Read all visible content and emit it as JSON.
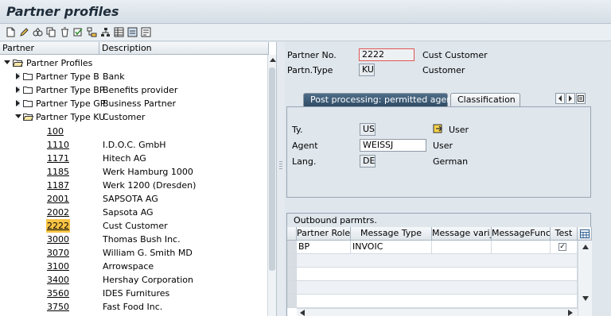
{
  "app": {
    "title": "Partner profiles"
  },
  "toolbar": {
    "buttons": [
      "new-icon",
      "edit-icon",
      "display-icon",
      "copy-icon",
      "delete-icon",
      "check-icon",
      "tree-icon",
      "hierarchy-icon",
      "table-icon",
      "table2-icon",
      "info-icon"
    ]
  },
  "tree": {
    "col_partner": "Partner",
    "col_description": "Description",
    "root": "Partner Profiles",
    "types": [
      {
        "label": "Partner Type B",
        "desc": "Bank"
      },
      {
        "label": "Partner Type BP",
        "desc": "Benefits provider"
      },
      {
        "label": "Partner Type GP",
        "desc": "Business Partner"
      },
      {
        "label": "Partner Type KU",
        "desc": "Customer"
      }
    ],
    "partners": [
      {
        "no": "100",
        "desc": ""
      },
      {
        "no": "1110",
        "desc": "I.D.O.C. GmbH"
      },
      {
        "no": "1171",
        "desc": "Hitech AG"
      },
      {
        "no": "1185",
        "desc": "Werk Hamburg 1000"
      },
      {
        "no": "1187",
        "desc": "Werk 1200 (Dresden)"
      },
      {
        "no": "2001",
        "desc": "SAPSOTA AG"
      },
      {
        "no": "2002",
        "desc": "Sapsota AG"
      },
      {
        "no": "2222",
        "desc": "Cust Customer"
      },
      {
        "no": "3000",
        "desc": "Thomas Bush Inc."
      },
      {
        "no": "3070",
        "desc": "William G. Smith MD"
      },
      {
        "no": "3100",
        "desc": "Arrowspace"
      },
      {
        "no": "3400",
        "desc": "Hershay Corporation"
      },
      {
        "no": "3560",
        "desc": "IDES Furnitures"
      },
      {
        "no": "3750",
        "desc": "Fast Food Inc."
      }
    ]
  },
  "header": {
    "partner_no_label": "Partner No.",
    "partner_no": "2222",
    "partner_name": "Cust Customer",
    "partn_type_label": "Partn.Type",
    "partn_type": "KU",
    "partn_type_desc": "Customer"
  },
  "tabs": {
    "active": "Post processing: permitted agent",
    "inactive": "Classification"
  },
  "agent": {
    "ty_label": "Ty.",
    "ty": "US",
    "ty_desc": "User",
    "agent_label": "Agent",
    "agent": "WEISSJ",
    "agent_desc": "User",
    "lang_label": "Lang.",
    "lang": "DE",
    "lang_desc": "German"
  },
  "outbound": {
    "title": "Outbound parmtrs.",
    "columns": [
      "Partner Role",
      "Message Type",
      "Message vari_",
      "MessageFunct_",
      "Test"
    ],
    "rows": [
      {
        "role": "BP",
        "msgtype": "INVOIC",
        "variant": "",
        "function": "",
        "test": true
      }
    ]
  }
}
